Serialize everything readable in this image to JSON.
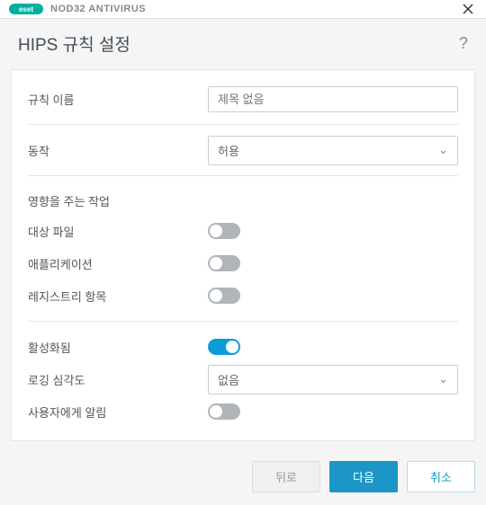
{
  "titlebar": {
    "brand": "eset",
    "product": "NOD32 ANTIVIRUS"
  },
  "header": {
    "title": "HIPS 규칙 설정"
  },
  "form": {
    "rule_name": {
      "label": "규칙 이름",
      "placeholder": "제목 없음",
      "value": ""
    },
    "action": {
      "label": "동작",
      "selected": "허용"
    },
    "operations_section": "영향을 주는 작업",
    "target_files": {
      "label": "대상 파일",
      "on": false
    },
    "applications": {
      "label": "애플리케이션",
      "on": false
    },
    "registry": {
      "label": "레지스트리 항목",
      "on": false
    },
    "enabled": {
      "label": "활성화됨",
      "on": true
    },
    "log_severity": {
      "label": "로깅 심각도",
      "selected": "없음"
    },
    "notify_user": {
      "label": "사용자에게 알림",
      "on": false
    }
  },
  "footer": {
    "back": "뒤로",
    "next": "다음",
    "cancel": "취소"
  }
}
